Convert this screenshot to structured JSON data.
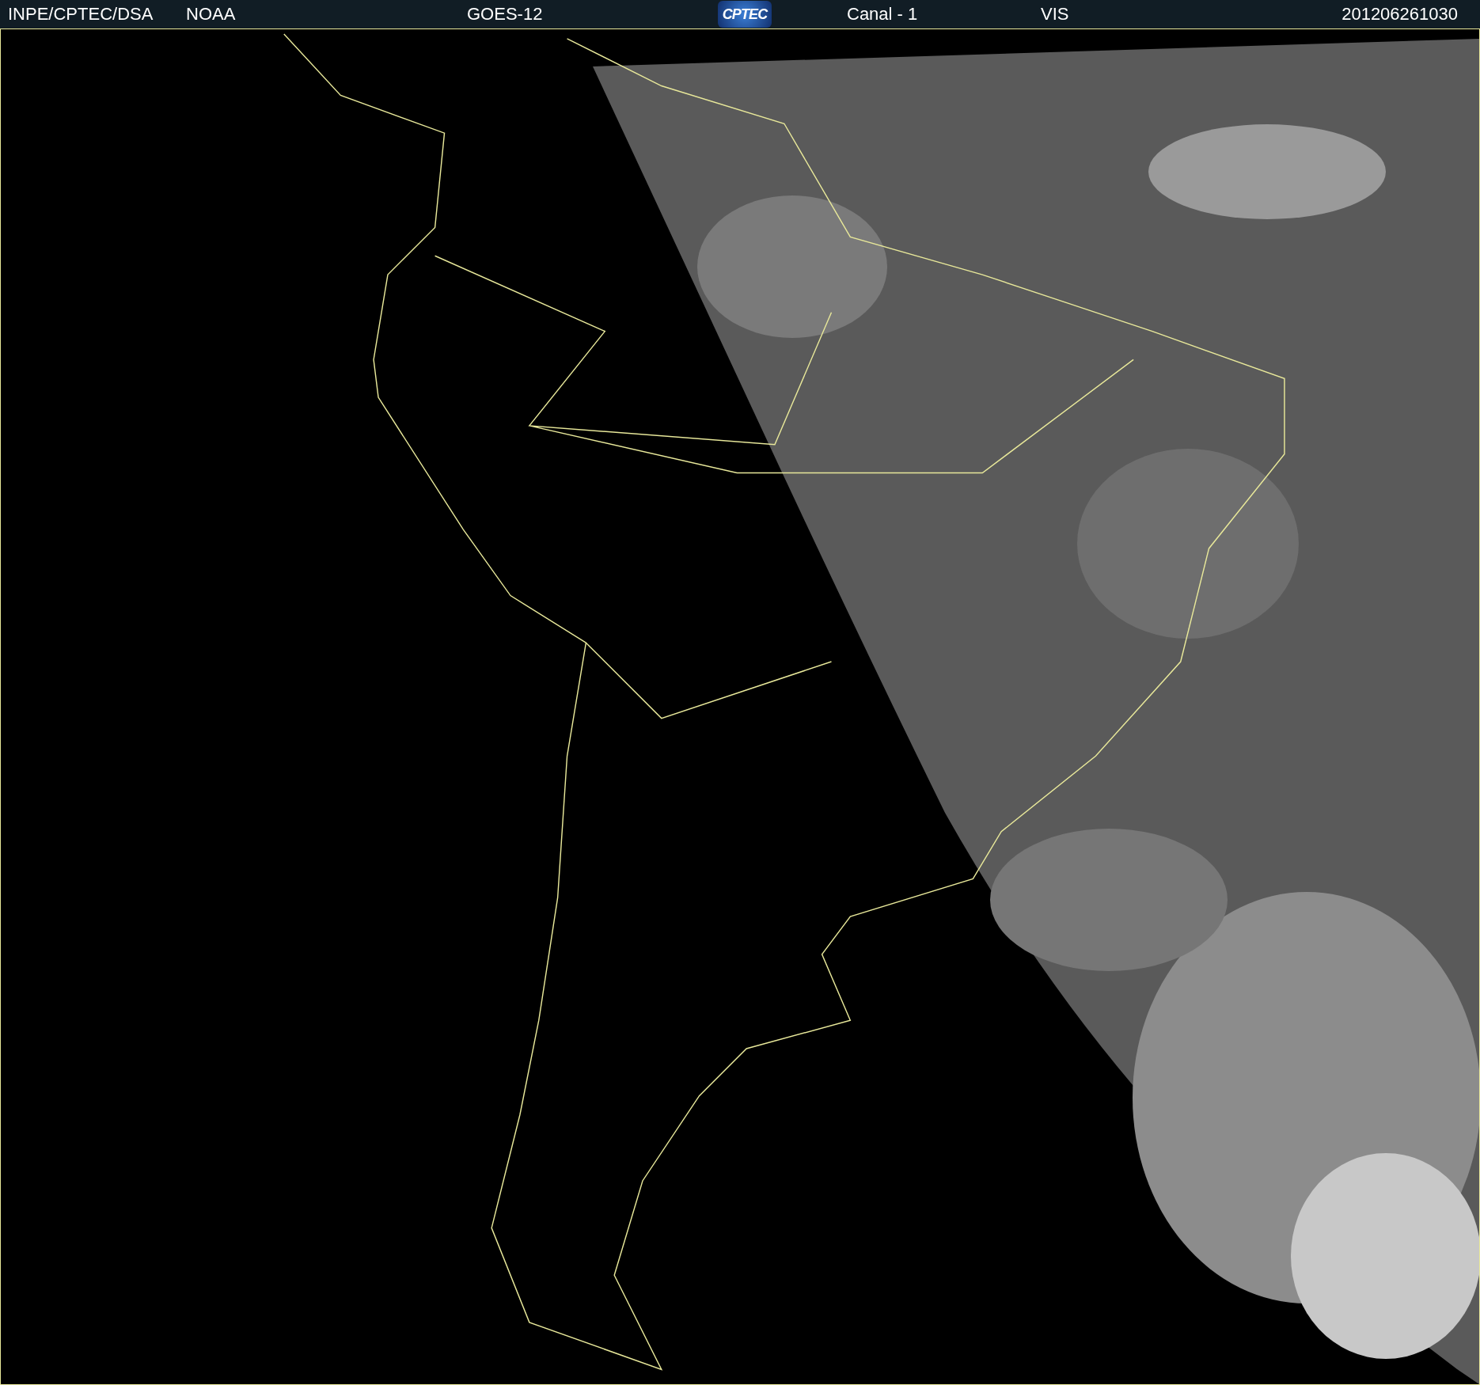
{
  "header": {
    "items": [
      {
        "kind": "text",
        "text": "INPE/CPTEC/DSA"
      },
      {
        "kind": "text",
        "text": "NOAA"
      },
      {
        "kind": "text",
        "text": "GOES-12"
      },
      {
        "kind": "logo",
        "text": "CPTEC"
      },
      {
        "kind": "text",
        "text": "Canal - 1"
      },
      {
        "kind": "text",
        "text": "VIS"
      },
      {
        "kind": "text",
        "text": "201206261030"
      }
    ]
  }
}
